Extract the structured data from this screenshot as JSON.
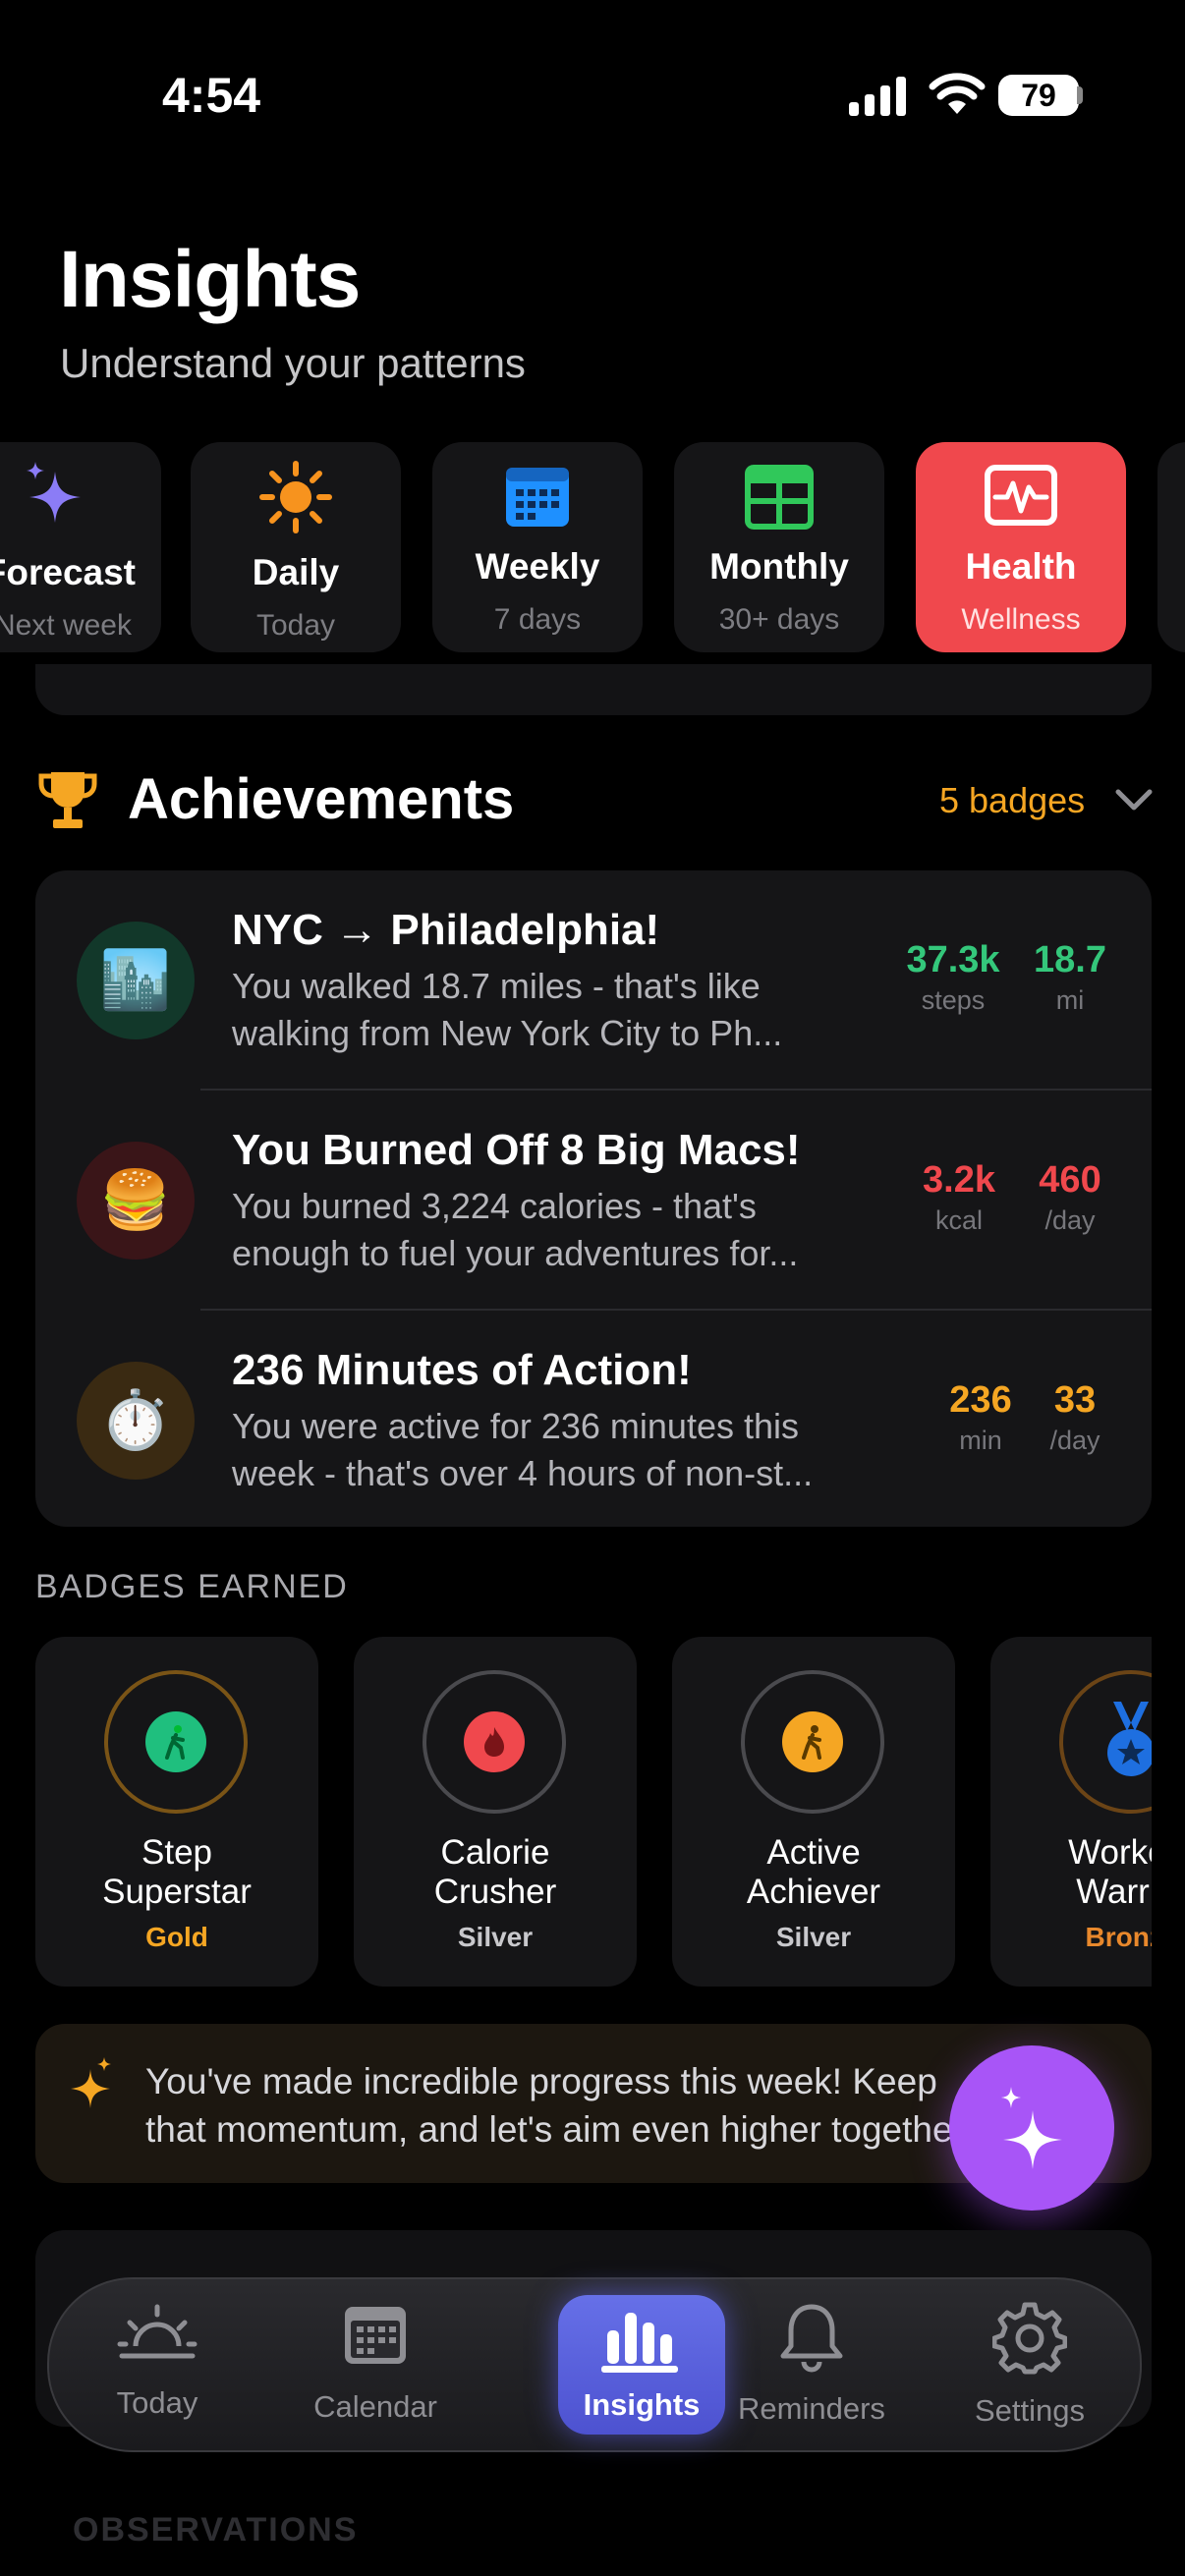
{
  "status_bar": {
    "time": "4:54",
    "battery": "79"
  },
  "header": {
    "title": "Insights",
    "subtitle": "Understand your patterns"
  },
  "view_tabs": [
    {
      "label": "Forecast",
      "sub": "Next week"
    },
    {
      "label": "Daily",
      "sub": "Today"
    },
    {
      "label": "Weekly",
      "sub": "7 days"
    },
    {
      "label": "Monthly",
      "sub": "30+ days"
    },
    {
      "label": "Health",
      "sub": "Wellness"
    }
  ],
  "achievements": {
    "title": "Achievements",
    "badge_count": "5 badges",
    "items": [
      {
        "icon": "🏙️",
        "title": "NYC → Philadelphia!",
        "desc_line1": "You walked 18.7 miles - that's like",
        "desc_line2": "walking from New York City to Ph...",
        "stat1_value": "37.3k",
        "stat1_unit": "steps",
        "stat2_value": "18.7",
        "stat2_unit": "mi",
        "color": "#34c77b"
      },
      {
        "icon": "🍔",
        "title": "You Burned Off 8 Big Macs!",
        "desc_line1": "You burned 3,224 calories - that's",
        "desc_line2": "enough to fuel your adventures for...",
        "stat1_value": "3.2k",
        "stat1_unit": "kcal",
        "stat2_value": "460",
        "stat2_unit": "/day",
        "color": "#f0484d"
      },
      {
        "icon": "⏱️",
        "title": "236 Minutes of Action!",
        "desc_line1": "You were active for 236 minutes this",
        "desc_line2": "week - that's over 4 hours of non-st...",
        "stat1_value": "236",
        "stat1_unit": "min",
        "stat2_value": "33",
        "stat2_unit": "/day",
        "color": "#f5a623"
      }
    ]
  },
  "badges": {
    "label": "BADGES EARNED",
    "items": [
      {
        "line1": "Step",
        "line2": "Superstar",
        "tier": "Gold"
      },
      {
        "line1": "Calorie",
        "line2": "Crusher",
        "tier": "Silver"
      },
      {
        "line1": "Active",
        "line2": "Achiever",
        "tier": "Silver"
      },
      {
        "line1": "Workout",
        "line2": "Warrior",
        "tier": "Bronze"
      }
    ]
  },
  "message": "You've made incredible progress this week! Keep that momentum, and let's aim even higher together!",
  "tabbar": {
    "today": "Today",
    "calendar": "Calendar",
    "insights": "Insights",
    "reminders": "Reminders",
    "settings": "Settings"
  },
  "observations_label": "OBSERVATIONS",
  "colors": {
    "health": "#f0484d",
    "accent_orange": "#f5a623",
    "fab": "#a855f7",
    "active_tab": "#5a60dc"
  }
}
